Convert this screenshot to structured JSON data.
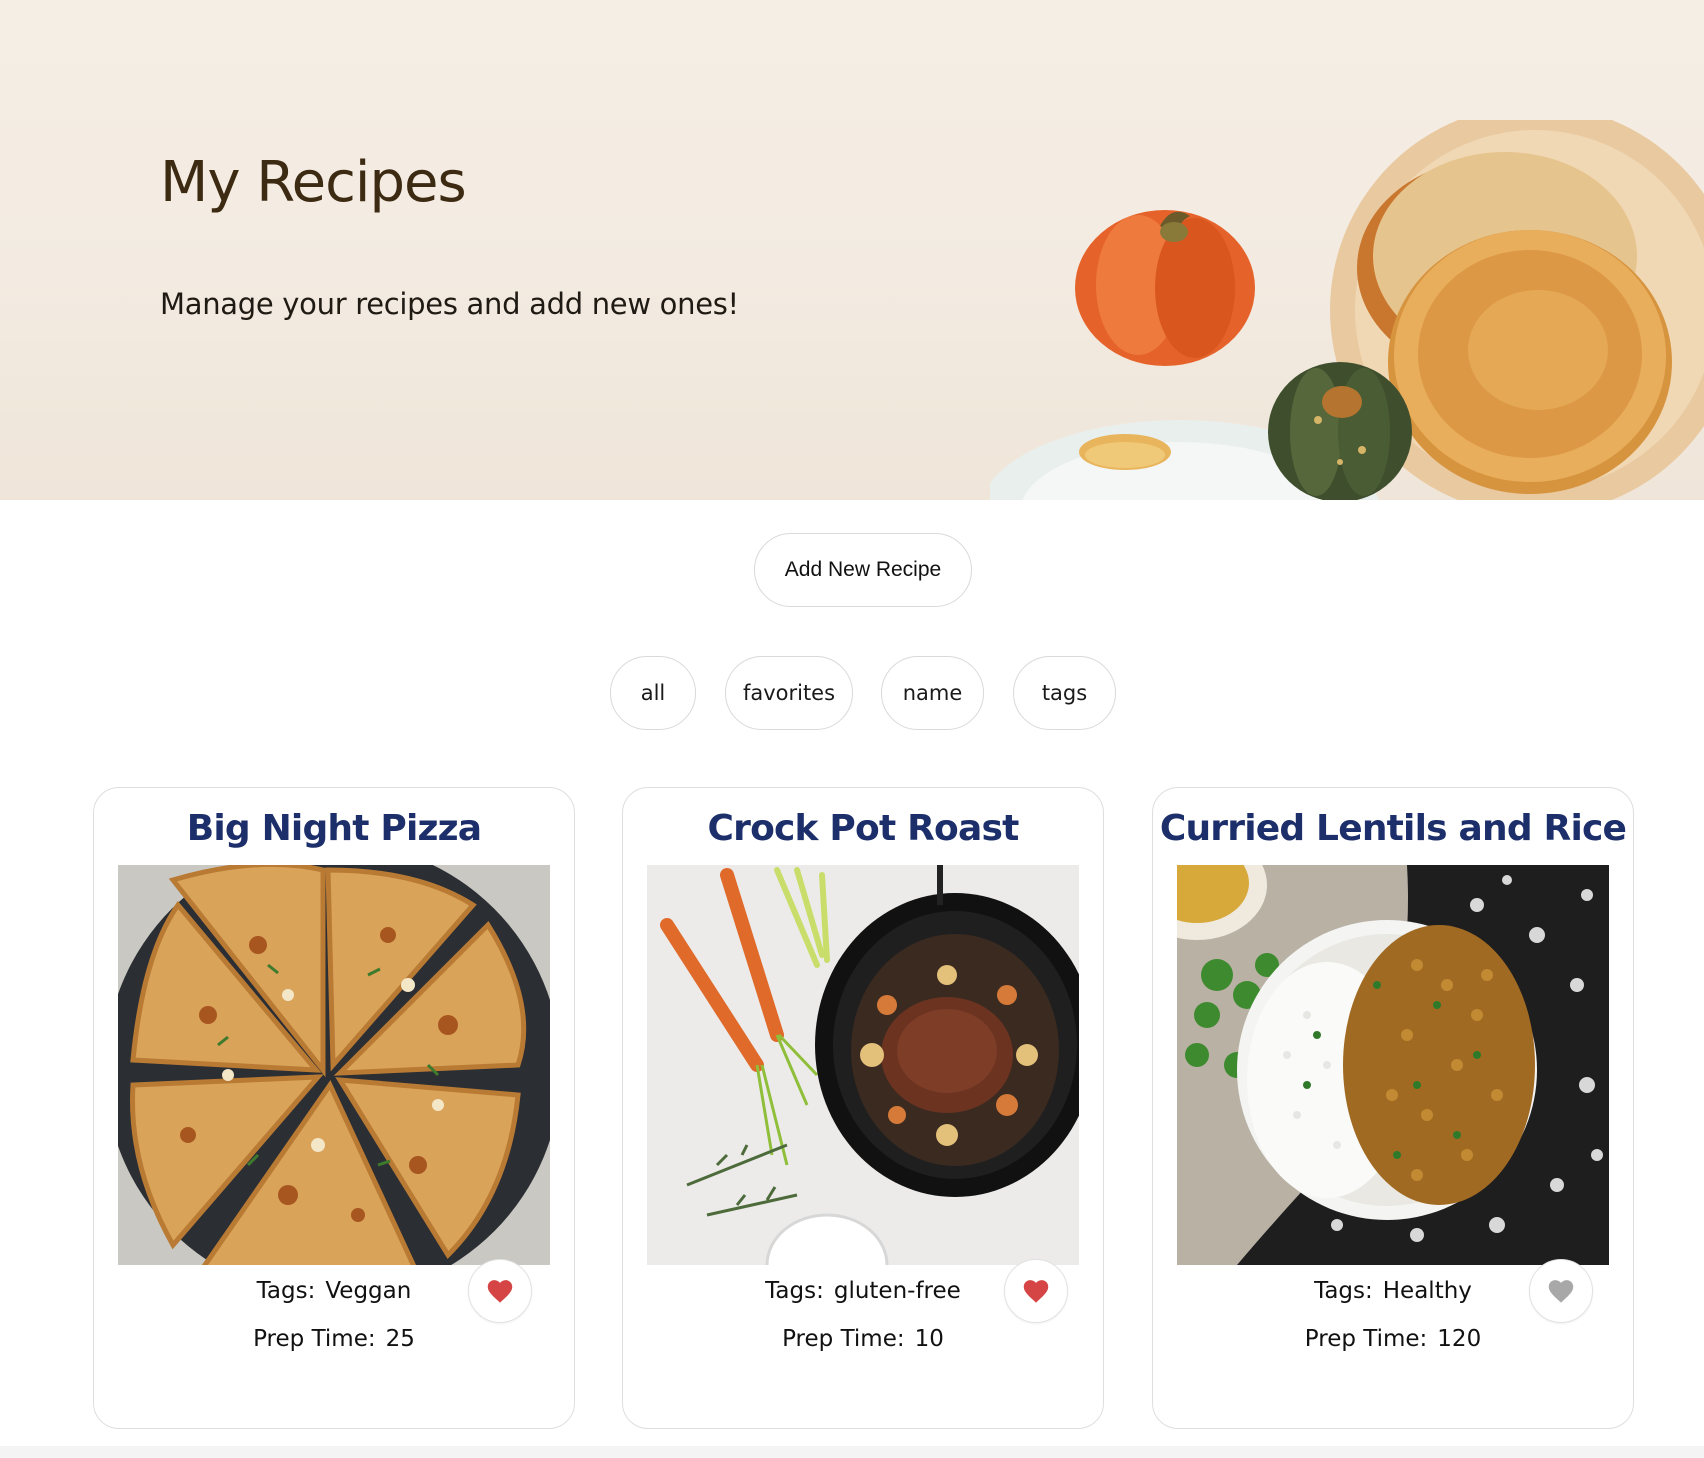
{
  "hero": {
    "title": "My Recipes",
    "subtitle": "Manage your recipes and add new ones!"
  },
  "actions": {
    "add_label": "Add New Recipe"
  },
  "filters": [
    {
      "label": "all"
    },
    {
      "label": "favorites"
    },
    {
      "label": "name"
    },
    {
      "label": "tags"
    }
  ],
  "meta_labels": {
    "tags": "Tags:",
    "prep": "Prep Time:"
  },
  "recipes": [
    {
      "title": "Big Night Pizza",
      "tags": "Veggan",
      "prep_time": "25",
      "favorite": true,
      "image": "pizza-photo"
    },
    {
      "title": "Crock Pot Roast",
      "tags": "gluten-free",
      "prep_time": "10",
      "favorite": true,
      "image": "roast-photo"
    },
    {
      "title": "Curried Lentils and Rice",
      "tags": "Healthy",
      "prep_time": "120",
      "favorite": false,
      "image": "lentils-photo"
    }
  ],
  "colors": {
    "heart_active": "#d64545",
    "heart_inactive": "#a8a8a8",
    "title_blue": "#1d2f6b",
    "hero_title": "#3d2a12"
  },
  "icons": {
    "favorite": "heart-icon"
  }
}
